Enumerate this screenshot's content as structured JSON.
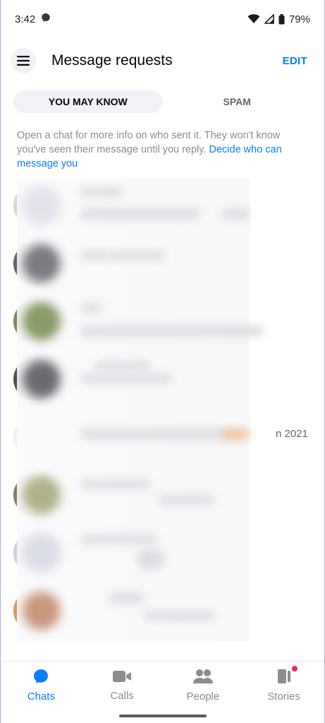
{
  "status_bar": {
    "time": "3:42",
    "battery": "79%",
    "icons": [
      "messenger-notification-icon",
      "wifi-icon",
      "signal-icon",
      "battery-icon"
    ]
  },
  "header": {
    "title": "Message requests",
    "edit_label": "EDIT",
    "menu_icon": "hamburger-menu-icon"
  },
  "tabs": [
    {
      "label": "YOU MAY KNOW",
      "active": true
    },
    {
      "label": "SPAM",
      "active": false
    }
  ],
  "info": {
    "text": "Open a chat for more info on who sent it. They won't know you've seen their message until you reply. ",
    "link": "Decide who can message you"
  },
  "requests": {
    "visible_date": "n 2021"
  },
  "bottom_nav": [
    {
      "label": "Chats",
      "icon": "chat-bubble-icon",
      "active": true
    },
    {
      "label": "Calls",
      "icon": "video-camera-icon",
      "active": false
    },
    {
      "label": "People",
      "icon": "people-icon",
      "active": false
    },
    {
      "label": "Stories",
      "icon": "stories-icon",
      "active": false,
      "badge": true
    }
  ],
  "colors": {
    "accent": "#0a7cff",
    "badge": "#f02849",
    "tab_active_bg": "#f0f2f5"
  }
}
